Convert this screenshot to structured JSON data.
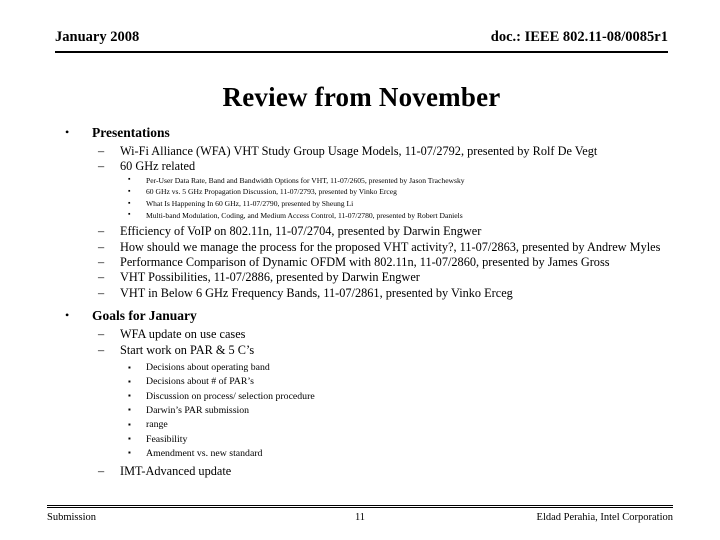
{
  "header": {
    "left": "January 2008",
    "right": "doc.: IEEE 802.11-08/0085r1"
  },
  "title": "Review from November",
  "markers": {
    "level1": "•",
    "level2": "–",
    "level3": "▪"
  },
  "sections": [
    {
      "heading": "Presentations",
      "items": [
        {
          "text": "Wi-Fi Alliance (WFA) VHT Study Group Usage Models, 11-07/2792, presented by Rolf De Vegt"
        },
        {
          "text": "60 GHz related",
          "subitems": [
            "Per-User Data Rate, Band and Bandwidth Options for VHT, 11-07/2605, presented by Jason Trachewsky",
            "60 GHz vs. 5 GHz Propagation Discussion, 11-07/2793, presented by Vinko Erceg",
            "What Is Happening In 60 GHz, 11-07/2790, presented by Sheung Li",
            "Multi-band Modulation, Coding, and Medium Access Control, 11-07/2780, presented by Robert Daniels"
          ]
        },
        {
          "text": "Efficiency of VoIP on 802.11n, 11-07/2704, presented by Darwin Engwer"
        },
        {
          "text": "How should we manage the process for the proposed VHT activity?, 11-07/2863, presented by Andrew Myles"
        },
        {
          "text": "Performance Comparison of Dynamic OFDM with 802.11n, 11-07/2860, presented by James Gross"
        },
        {
          "text": "VHT Possibilities, 11-07/2886, presented by Darwin Engwer"
        },
        {
          "text": "VHT in Below 6 GHz Frequency Bands, 11-07/2861, presented by Vinko Erceg"
        }
      ]
    },
    {
      "heading": "Goals for January",
      "items": [
        {
          "text": "WFA update on use cases"
        },
        {
          "text": "Start work on PAR & 5 C’s",
          "subitems": [
            "Decisions about operating band",
            "Decisions about # of PAR’s",
            "Discussion on process/ selection procedure",
            "Darwin’s PAR submission",
            "range",
            "Feasibility",
            "Amendment vs. new standard"
          ]
        },
        {
          "text": "IMT-Advanced update"
        }
      ]
    }
  ],
  "footer": {
    "left": "Submission",
    "page": "11",
    "right": "Eldad Perahia, Intel Corporation"
  }
}
